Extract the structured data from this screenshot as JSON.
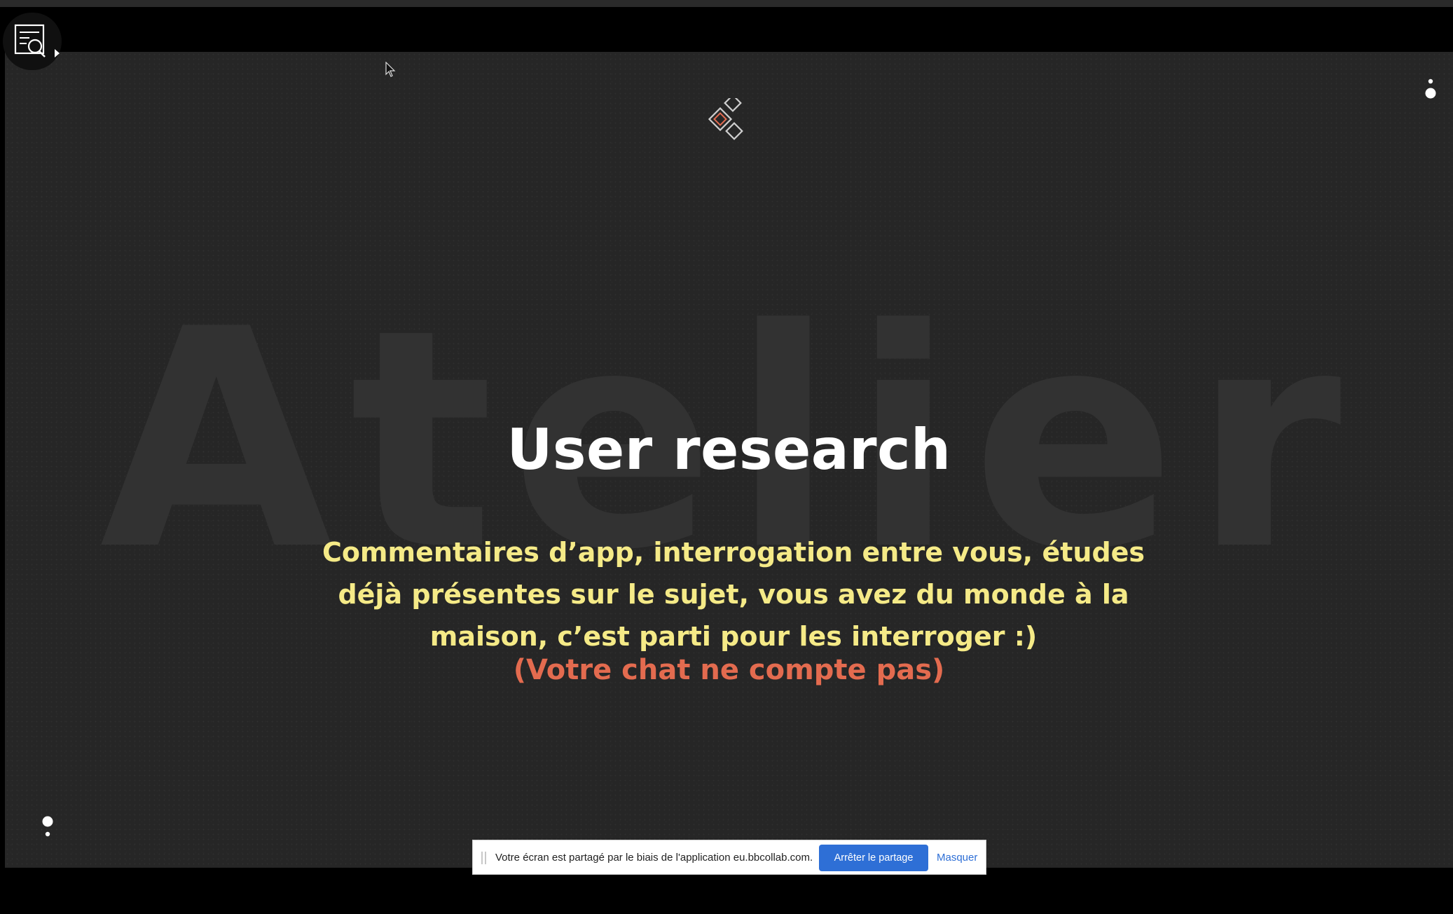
{
  "slide": {
    "watermark": "Atelier",
    "title": "User research",
    "body": "Commentaires d’app, interrogation entre vous, études déjà présentes sur le sujet, vous avez du monde à la maison, c’est parti pour les interroger :)",
    "note": "(Votre chat ne compte pas)"
  },
  "icons": {
    "tool": "document-search-icon",
    "menu": "dots-menu-icon",
    "logo": "diamonds-logo-icon"
  },
  "share_bar": {
    "message": "Votre écran est partagé par le biais de l'application eu.bbcollab.com.",
    "stop_label": "Arrêter le partage",
    "hide_label": "Masquer"
  },
  "colors": {
    "slide_background": "#262626",
    "title": "#ffffff",
    "body": "#f5ea87",
    "note": "#e36b4f",
    "accent_button": "#2e6fd6"
  }
}
